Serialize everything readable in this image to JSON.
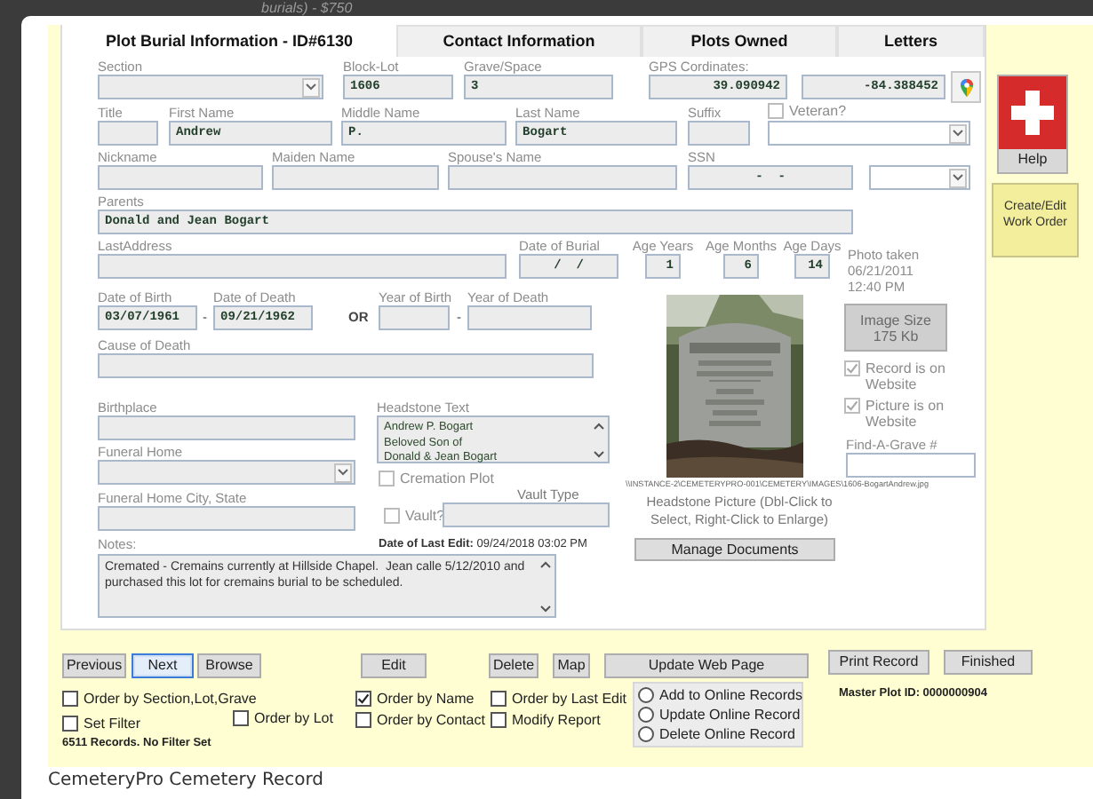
{
  "caption_above": "burials) - $750",
  "tabs": [
    {
      "label": "Plot Burial Information - ID#6130",
      "selected": true
    },
    {
      "label": "Contact Information",
      "selected": false
    },
    {
      "label": "Plots Owned",
      "selected": false
    },
    {
      "label": "Letters",
      "selected": false
    }
  ],
  "form": {
    "section": {
      "label": "Section"
    },
    "block_lot": {
      "label": "Block-Lot",
      "value": "1606"
    },
    "grave_space": {
      "label": "Grave/Space",
      "value": "3"
    },
    "gps": {
      "label": "GPS Cordinates:",
      "latitude": "39.090942",
      "longitude": "-84.388452"
    },
    "title": {
      "label": "Title"
    },
    "first_name": {
      "label": "First Name",
      "value": "Andrew"
    },
    "middle_name": {
      "label": "Middle Name",
      "value": "P."
    },
    "last_name": {
      "label": "Last Name",
      "value": "Bogart"
    },
    "suffix": {
      "label": "Suffix"
    },
    "veteran": {
      "label": "Veteran?",
      "checked": false
    },
    "nickname": {
      "label": "Nickname"
    },
    "maiden_name": {
      "label": "Maiden Name"
    },
    "spouse_name": {
      "label": "Spouse's Name"
    },
    "ssn": {
      "label": "SSN",
      "value": "-  -"
    },
    "parents": {
      "label": "Parents",
      "value": "Donald and Jean Bogart"
    },
    "last_address": {
      "label": "LastAddress"
    },
    "date_of_burial": {
      "label": "Date of Burial",
      "value": "/  /"
    },
    "age_years": {
      "label": "Age Years",
      "value": "1"
    },
    "age_months": {
      "label": "Age Months",
      "value": "6"
    },
    "age_days": {
      "label": "Age Days",
      "value": "14"
    },
    "photo_taken": "Photo taken\n06/21/2011\n12:40 PM",
    "date_of_birth": {
      "label": "Date of Birth",
      "value": "03/07/1961"
    },
    "date_dash": "-",
    "date_of_death": {
      "label": "Date of Death",
      "value": "09/21/1962"
    },
    "or_label": "OR",
    "year_of_birth": {
      "label": "Year of Birth"
    },
    "year_dash": "-",
    "year_of_death": {
      "label": "Year of Death"
    },
    "image_size": {
      "label": "Image Size\n175 Kb",
      "disabled": true
    },
    "record_on_website": {
      "label": "Record is on Website",
      "checked": true
    },
    "picture_on_website": {
      "label": "Picture is on Website",
      "checked": true
    },
    "find_a_grave": {
      "label": "Find-A-Grave #"
    },
    "cause_of_death": {
      "label": "Cause of Death"
    },
    "birthplace": {
      "label": "Birthplace"
    },
    "headstone_text": {
      "label": "Headstone Text",
      "lines": [
        "Andrew P. Bogart",
        "Beloved Son of",
        "Donald & Jean Bogart"
      ]
    },
    "funeral_home": {
      "label": "Funeral Home"
    },
    "cremation_plot": {
      "label": "Cremation Plot",
      "checked": false
    },
    "vault_type": {
      "label": "Vault Type"
    },
    "vault": {
      "label": "Vault?",
      "checked": false
    },
    "funeral_home_city": {
      "label": "Funeral Home City, State"
    },
    "photo_path": "\\\\INSTANCE-2\\CEMETERYPRO-001\\CEMETERY\\IMAGES\\1606-BogartAndrew.jpg",
    "photo_caption": "Headstone Picture (Dbl-Click to Select, Right-Click to Enlarge)",
    "manage_documents": "Manage Documents",
    "notes": {
      "label": "Notes:",
      "value": "Cremated - Cremains currently at Hillside Chapel.  Jean calle 5/12/2010 and purchased this lot for cremains burial to be scheduled."
    },
    "last_edit": "**Date of Last Edit:** 09/24/2018 03:02 PM"
  },
  "sidebar": {
    "help": "Help",
    "work_order": "Create/Edit Work Order"
  },
  "toolbar": [
    {
      "label": "Previous",
      "focused": false
    },
    {
      "label": "Next",
      "focused": true
    },
    {
      "label": "Browse",
      "focused": false
    },
    {
      "label": "Edit",
      "focused": false
    },
    {
      "label": "Delete",
      "focused": false
    },
    {
      "label": "Map",
      "focused": false
    },
    {
      "label": "Update Web Page",
      "focused": false
    },
    {
      "label": "Print Record",
      "focused": false
    },
    {
      "label": "Finished",
      "focused": false
    }
  ],
  "order_options": [
    {
      "label": "Order by Section,Lot,Grave",
      "checked": false
    },
    {
      "label": "Set Filter",
      "checked": false
    },
    {
      "label": "Order by Lot",
      "checked": false
    },
    {
      "label": "Order by Name",
      "checked": true
    },
    {
      "label": "Order by Contact",
      "checked": false
    },
    {
      "label": "Order by Last Edit",
      "checked": false
    },
    {
      "label": "Modify Report",
      "checked": false
    }
  ],
  "online_actions": [
    {
      "label": "Add to Online Records",
      "selected": false
    },
    {
      "label": "Update Online Record",
      "selected": false
    },
    {
      "label": "Delete Online Record",
      "selected": false
    }
  ],
  "master_plot_id": "Master Plot ID: 0000000904",
  "record_count": "6511 Records. No Filter Set",
  "footer": "CemeteryPro Cemetery Record"
}
